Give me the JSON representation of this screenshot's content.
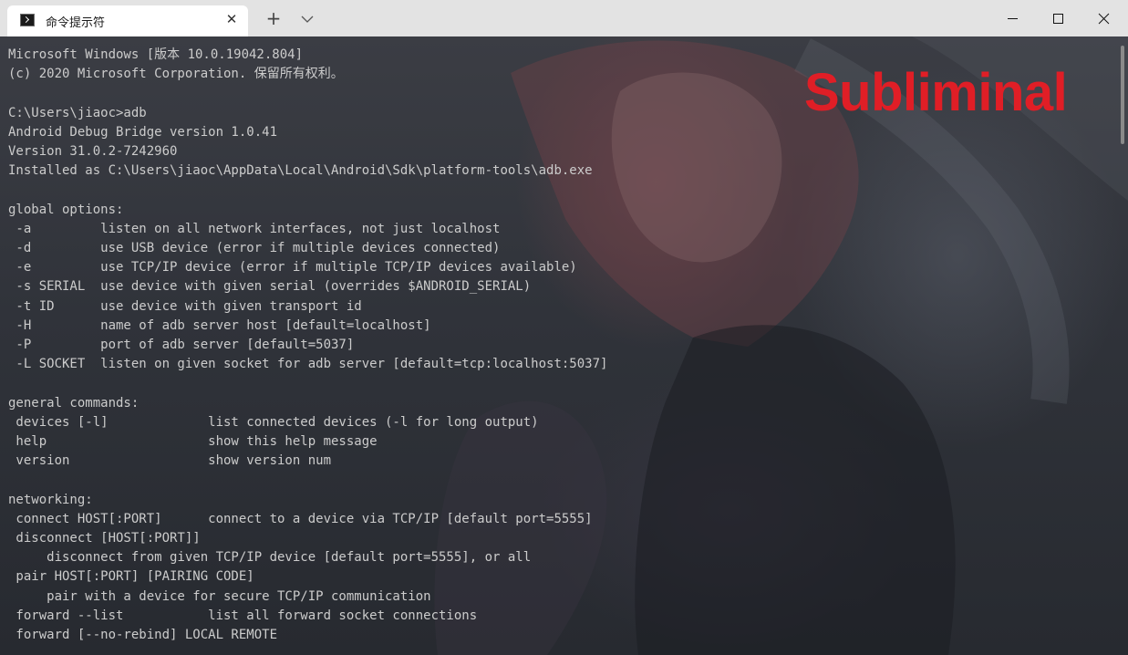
{
  "window": {
    "tab_title": "命令提示符",
    "tab_icon": "terminal-icon",
    "tab_close_icon": "close-icon",
    "new_tab_icon": "plus-icon",
    "dropdown_icon": "chevron-down-icon",
    "controls": [
      "minimize-icon",
      "maximize-icon",
      "close-icon"
    ]
  },
  "terminal": {
    "text_color": "#cccccc",
    "lines": [
      "Microsoft Windows [版本 10.0.19042.804]",
      "(c) 2020 Microsoft Corporation. 保留所有权利。",
      "",
      "C:\\Users\\jiaoc>adb",
      "Android Debug Bridge version 1.0.41",
      "Version 31.0.2-7242960",
      "Installed as C:\\Users\\jiaoc\\AppData\\Local\\Android\\Sdk\\platform-tools\\adb.exe",
      "",
      "global options:",
      " -a         listen on all network interfaces, not just localhost",
      " -d         use USB device (error if multiple devices connected)",
      " -e         use TCP/IP device (error if multiple TCP/IP devices available)",
      " -s SERIAL  use device with given serial (overrides $ANDROID_SERIAL)",
      " -t ID      use device with given transport id",
      " -H         name of adb server host [default=localhost]",
      " -P         port of adb server [default=5037]",
      " -L SOCKET  listen on given socket for adb server [default=tcp:localhost:5037]",
      "",
      "general commands:",
      " devices [-l]             list connected devices (-l for long output)",
      " help                     show this help message",
      " version                  show version num",
      "",
      "networking:",
      " connect HOST[:PORT]      connect to a device via TCP/IP [default port=5555]",
      " disconnect [HOST[:PORT]]",
      "     disconnect from given TCP/IP device [default port=5555], or all",
      " pair HOST[:PORT] [PAIRING CODE]",
      "     pair with a device for secure TCP/IP communication",
      " forward --list           list all forward socket connections",
      " forward [--no-rebind] LOCAL REMOTE"
    ]
  },
  "watermark": {
    "text": "Subliminal",
    "color": "#e01e26"
  }
}
